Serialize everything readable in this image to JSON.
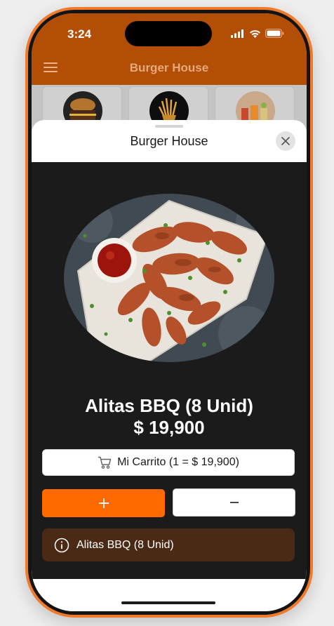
{
  "status_bar": {
    "time": "3:24"
  },
  "app": {
    "title": "Burger House"
  },
  "categories": [
    {
      "icon": "burger-image"
    },
    {
      "icon": "fries-image"
    },
    {
      "icon": "drinks-image"
    }
  ],
  "modal": {
    "title": "Burger House",
    "close_icon": "close-icon"
  },
  "product": {
    "name": "Alitas BBQ (8 Unid)",
    "price": "$ 19,900",
    "image": "bbq-wings-image"
  },
  "cart_button": {
    "label": "Mi Carrito (1 = $ 19,900)",
    "icon": "cart-icon"
  },
  "quantity": {
    "plus_icon": "plus-icon",
    "minus_icon": "minus-icon"
  },
  "info": {
    "text": "Alitas BBQ (8 Unid)",
    "icon": "info-icon"
  },
  "colors": {
    "header": "#b24e06",
    "accent": "#ff6a00",
    "content_bg": "#1b1b1b",
    "info_bg": "#4b2a15",
    "phone_frame": "#f07a2a"
  }
}
